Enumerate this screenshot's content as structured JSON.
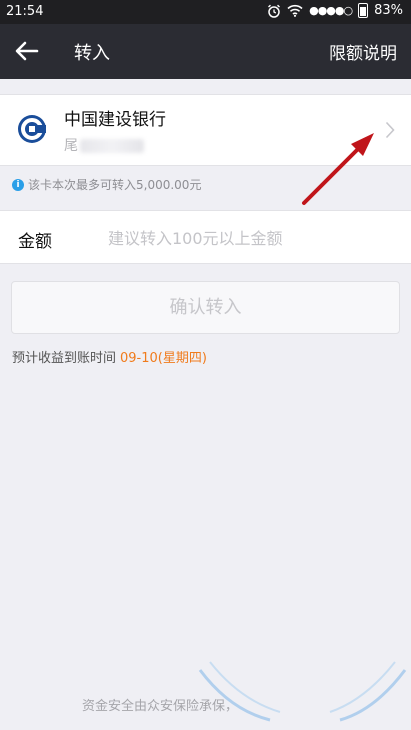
{
  "status_bar": {
    "time": "21:54",
    "signal": "●●●●○",
    "battery": "83%",
    "icons": [
      "alarm-icon",
      "wifi-icon",
      "signal-icon",
      "battery-icon"
    ]
  },
  "navbar": {
    "title": "转入",
    "right_action": "限额说明",
    "back_icon": "arrow-left-icon"
  },
  "bank_card": {
    "bank_name": "中国建设银行",
    "card_tail_prefix": "尾",
    "logo_icon": "ccb-logo",
    "chevron_icon": "chevron-right-icon"
  },
  "limit_note": "该卡本次最多可转入5,000.00元",
  "amount": {
    "label": "金额",
    "placeholder": "建议转入100元以上金额",
    "value": ""
  },
  "confirm_button": "确认转入",
  "arrival": {
    "label": "预计收益到账时间",
    "date": "09-10(星期四)"
  },
  "footer_note": "资金安全由众安保险承保，",
  "colors": {
    "navbar_bg": "#2b2c33",
    "accent_orange": "#f07b1c",
    "info_blue": "#2a9fe8",
    "annotation_red": "#c0151a"
  }
}
